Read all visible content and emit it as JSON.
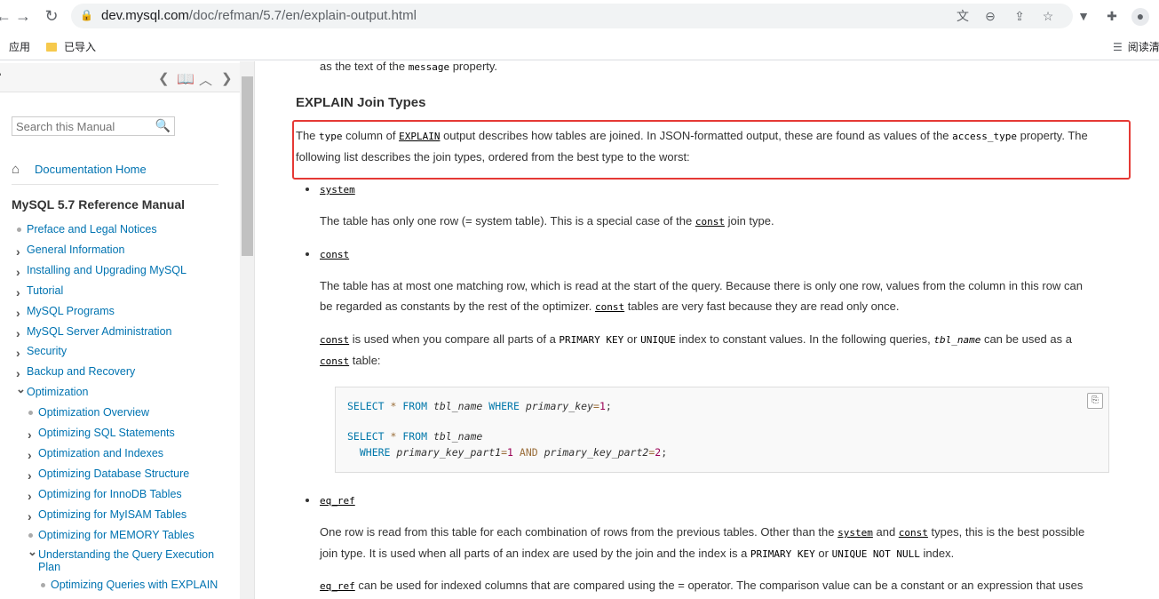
{
  "browser": {
    "url_host": "dev.mysql.com",
    "url_path": "/doc/refman/5.7/en/explain-output.html",
    "bookmarks": [
      {
        "label": "应用"
      },
      {
        "label": "已导入"
      }
    ],
    "reading_list": "阅读清"
  },
  "sidebar": {
    "search_placeholder": "Search this Manual",
    "doc_home": "Documentation Home",
    "manual_title": "MySQL 5.7 Reference Manual",
    "toc": [
      {
        "label": "Preface and Legal Notices",
        "marker": "dot",
        "level": 0
      },
      {
        "label": "General Information",
        "marker": "right",
        "level": 0
      },
      {
        "label": "Installing and Upgrading MySQL",
        "marker": "right",
        "level": 0
      },
      {
        "label": "Tutorial",
        "marker": "right",
        "level": 0
      },
      {
        "label": "MySQL Programs",
        "marker": "right",
        "level": 0
      },
      {
        "label": "MySQL Server Administration",
        "marker": "right",
        "level": 0
      },
      {
        "label": "Security",
        "marker": "right",
        "level": 0
      },
      {
        "label": "Backup and Recovery",
        "marker": "right",
        "level": 0
      },
      {
        "label": "Optimization",
        "marker": "down",
        "level": 0
      },
      {
        "label": "Optimization Overview",
        "marker": "dot",
        "level": 1
      },
      {
        "label": "Optimizing SQL Statements",
        "marker": "right",
        "level": 1
      },
      {
        "label": "Optimization and Indexes",
        "marker": "right",
        "level": 1
      },
      {
        "label": "Optimizing Database Structure",
        "marker": "right",
        "level": 1
      },
      {
        "label": "Optimizing for InnoDB Tables",
        "marker": "right",
        "level": 1
      },
      {
        "label": "Optimizing for MyISAM Tables",
        "marker": "right",
        "level": 1
      },
      {
        "label": "Optimizing for MEMORY Tables",
        "marker": "dot",
        "level": 1
      },
      {
        "label": "Understanding the Query Execution",
        "label2": "Plan",
        "marker": "down",
        "level": 1
      },
      {
        "label": "Optimizing Queries with EXPLAIN",
        "marker": "dot",
        "level": 2
      }
    ]
  },
  "content": {
    "top_fragment_pre": "as the text of the ",
    "top_fragment_code": "message",
    "top_fragment_post": " property.",
    "heading": "EXPLAIN Join Types",
    "intro": {
      "t1": "The ",
      "c1": "type",
      "t2": " column of ",
      "c2": "EXPLAIN",
      "t3": " output describes how tables are joined. In JSON-formatted output, these are found as values of the ",
      "c3": "access_type",
      "t4": " property. The",
      "line2": "following list describes the join types, ordered from the best type to the worst:"
    },
    "system": {
      "term": "system",
      "t1": "The table has only one row (= system table). This is a special case of the ",
      "c1": "const",
      "t2": " join type."
    },
    "const": {
      "term": "const",
      "p1_line1": "The table has at most one matching row, which is read at the start of the query. Because there is only one row, values from the column in this row can",
      "p1_l2_t1": "be regarded as constants by the rest of the optimizer. ",
      "p1_l2_c1": "const",
      "p1_l2_t2": " tables are very fast because they are read only once.",
      "p2_c1": "const",
      "p2_t1": " is used when you compare all parts of a ",
      "p2_c2": "PRIMARY KEY",
      "p2_t2": " or ",
      "p2_c3": "UNIQUE",
      "p2_t3": " index to constant values. In the following queries, ",
      "p2_c4": "tbl_name",
      "p2_t4": " can be used as a",
      "p2_l2_c1": "const",
      "p2_l2_t1": " table:"
    },
    "code": {
      "l1_kw1": "SELECT",
      "l1_op": " * ",
      "l1_kw2": "FROM",
      "l1_it1": " tbl_name ",
      "l1_kw3": "WHERE",
      "l1_it2": " primary_key",
      "l1_eq": "=",
      "l1_num": "1",
      "l1_end": ";",
      "l2_kw1": "SELECT",
      "l2_op": " * ",
      "l2_kw2": "FROM",
      "l2_it1": " tbl_name",
      "l3_kw1": "WHERE",
      "l3_it1": " primary_key_part1",
      "l3_eq1": "=",
      "l3_num1": "1",
      "l3_kw2": " AND ",
      "l3_it2": "primary_key_part2",
      "l3_eq2": "=",
      "l3_num2": "2",
      "l3_end": ";"
    },
    "eq_ref": {
      "term": "eq_ref",
      "p1_t1": "One row is read from this table for each combination of rows from the previous tables. Other than the ",
      "p1_c1": "system",
      "p1_t2": " and ",
      "p1_c2": "const",
      "p1_t3": " types, this is the best possible",
      "p1_l2_t1": "join type. It is used when all parts of an index are used by the join and the index is a ",
      "p1_l2_c1": "PRIMARY KEY",
      "p1_l2_t2": " or ",
      "p1_l2_c2": "UNIQUE NOT NULL",
      "p1_l2_t3": " index.",
      "p2_c1": "eq_ref",
      "p2_t1": " can be used for indexed columns that are compared using the ",
      "p2_c2": "=",
      "p2_t2": " operator. The comparison value can be a constant or an expression that uses"
    }
  }
}
